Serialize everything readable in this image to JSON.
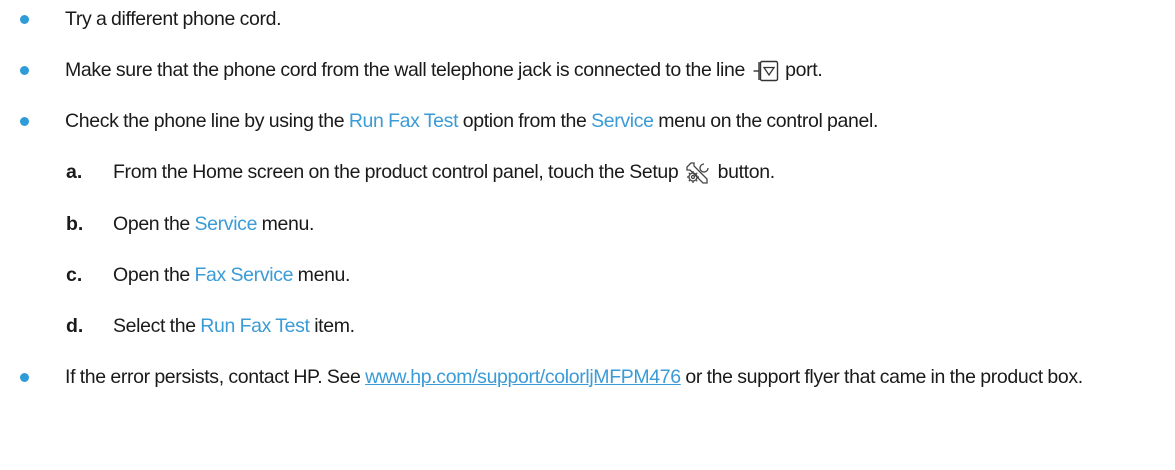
{
  "bullets": [
    {
      "text": "Try a different phone cord."
    },
    {
      "text_before": "Make sure that the phone cord from the wall telephone jack is connected to the line",
      "icon": "line-port-icon",
      "text_after": "port."
    },
    {
      "text_before": "Check the phone line by using the ",
      "link1": "Run Fax Test",
      "text_middle": " option from the ",
      "link2": "Service",
      "text_after": " menu on the control panel."
    }
  ],
  "steps": [
    {
      "letter": "a.",
      "text_before": "From the Home screen on the product control panel, touch the Setup",
      "icon": "setup-wrench-icon",
      "text_after": "button."
    },
    {
      "letter": "b.",
      "text_before": "Open the ",
      "link": "Service",
      "text_after": " menu."
    },
    {
      "letter": "c.",
      "text_before": "Open the ",
      "link": "Fax Service",
      "text_after": " menu."
    },
    {
      "letter": "d.",
      "text_before": "Select the ",
      "link": "Run Fax Test",
      "text_after": " item."
    }
  ],
  "last_bullet": {
    "text_before": "If the error persists, contact HP. See ",
    "url": "www.hp.com/support/colorljMFPM476",
    "text_after": " or the support flyer that came in the product box."
  },
  "colors": {
    "accent": "#3a9bd6",
    "bullet": "#2f9bd8",
    "text": "#1a1a1a"
  }
}
